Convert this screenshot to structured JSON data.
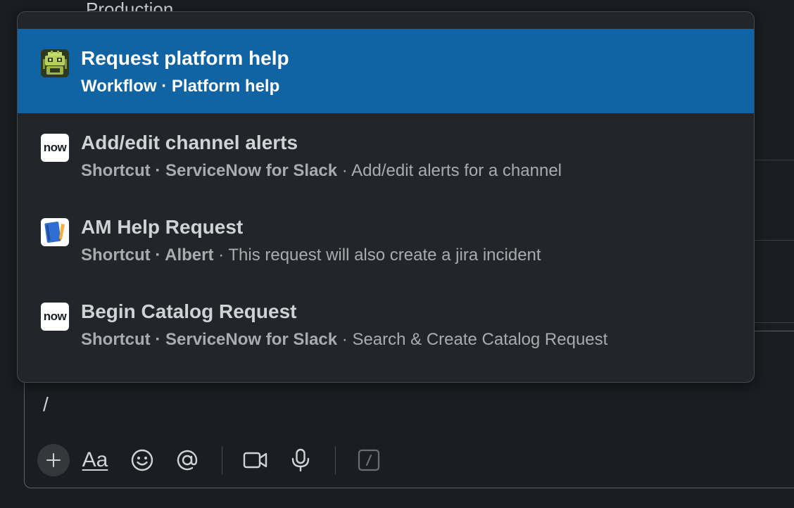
{
  "background": {
    "channel_text": "Production"
  },
  "popup": {
    "items": [
      {
        "title": "Request platform help",
        "type": "Workflow",
        "app": "Platform help",
        "description": "",
        "icon": "robot-app-icon",
        "selected": true
      },
      {
        "title": "Add/edit channel alerts",
        "type": "Shortcut",
        "app": "ServiceNow for Slack",
        "description": "Add/edit alerts for a channel",
        "icon": "now-app-icon",
        "logo_text": "now",
        "selected": false
      },
      {
        "title": "AM Help Request",
        "type": "Shortcut",
        "app": "Albert",
        "description": "This request will also create a jira incident",
        "icon": "notebook-app-icon",
        "selected": false
      },
      {
        "title": "Begin Catalog Request",
        "type": "Shortcut",
        "app": "ServiceNow for Slack",
        "description": "Search & Create Catalog Request",
        "icon": "now-app-icon",
        "logo_text": "now",
        "selected": false
      }
    ]
  },
  "composer": {
    "input_text": "/",
    "toolbar": {
      "format_label": "Aa",
      "icons": [
        "plus-icon",
        "formatting-icon",
        "emoji-icon",
        "mention-icon",
        "video-icon",
        "microphone-icon",
        "slash-command-icon"
      ]
    }
  },
  "colors": {
    "background": "#1a1d21",
    "popup": "#222529",
    "selected": "#1164a3",
    "text": "#d1d2d3",
    "muted": "#ababad"
  }
}
